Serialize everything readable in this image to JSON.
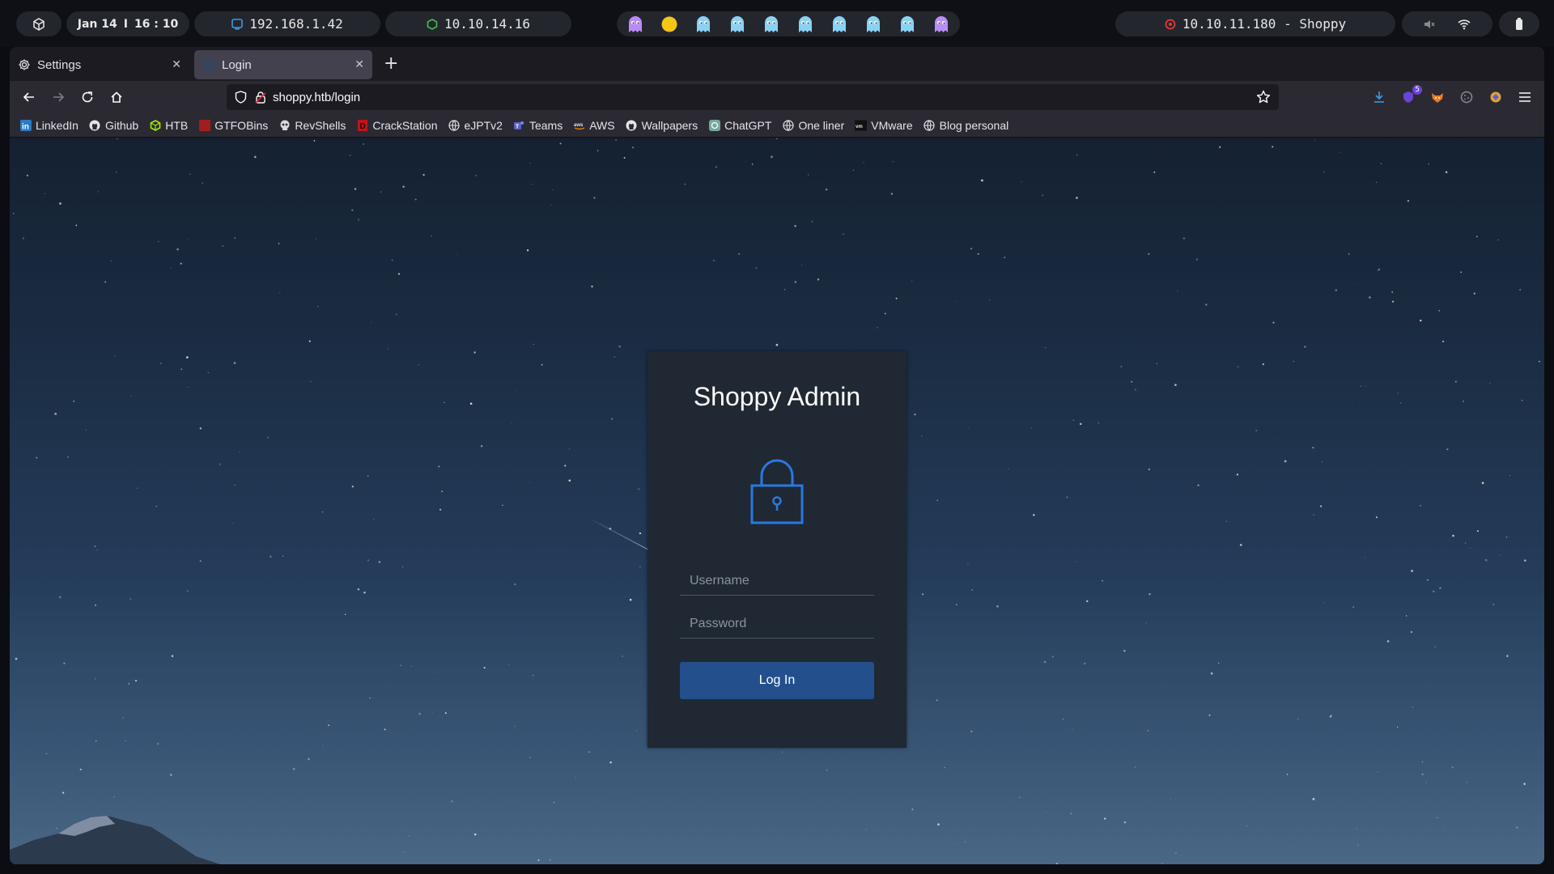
{
  "system_bar": {
    "date": "Jan 14",
    "separator": "I",
    "time": "16 : 10",
    "local_ip": "192.168.1.42",
    "vpn_ip": "10.10.14.16",
    "target": "10.10.11.180 - Shoppy",
    "workspaces": [
      "ghost-purple",
      "pacman-yellow",
      "ghost-blue",
      "ghost-blue",
      "ghost-blue",
      "ghost-blue",
      "ghost-blue",
      "ghost-blue",
      "ghost-blue",
      "ghost-purple"
    ]
  },
  "browser": {
    "tabs": [
      {
        "label": "Settings",
        "icon": "gear-icon",
        "active": false
      },
      {
        "label": "Login",
        "icon": "globe-icon",
        "active": true
      }
    ],
    "new_tab": "+",
    "url": "shoppy.htb/login",
    "downloads_badge": "5",
    "bookmarks": [
      {
        "label": "LinkedIn",
        "icon": "linkedin-icon"
      },
      {
        "label": "Github",
        "icon": "github-icon"
      },
      {
        "label": "HTB",
        "icon": "htb-icon"
      },
      {
        "label": "GTFOBins",
        "icon": "gtfobins-icon"
      },
      {
        "label": "RevShells",
        "icon": "skull-icon"
      },
      {
        "label": "CrackStation",
        "icon": "crackstation-icon"
      },
      {
        "label": "eJPTv2",
        "icon": "globe-icon"
      },
      {
        "label": "Teams",
        "icon": "teams-icon"
      },
      {
        "label": "AWS",
        "icon": "aws-icon"
      },
      {
        "label": "Wallpapers",
        "icon": "github-icon"
      },
      {
        "label": "ChatGPT",
        "icon": "chatgpt-icon"
      },
      {
        "label": "One liner",
        "icon": "globe-icon"
      },
      {
        "label": "VMware",
        "icon": "vmware-icon"
      },
      {
        "label": "Blog personal",
        "icon": "globe-icon"
      }
    ]
  },
  "login": {
    "title": "Shoppy Admin",
    "username_placeholder": "Username",
    "password_placeholder": "Password",
    "button_label": "Log In"
  },
  "colors": {
    "accent": "#2a6fd6",
    "button": "#23508d",
    "card": "#1f2833"
  }
}
